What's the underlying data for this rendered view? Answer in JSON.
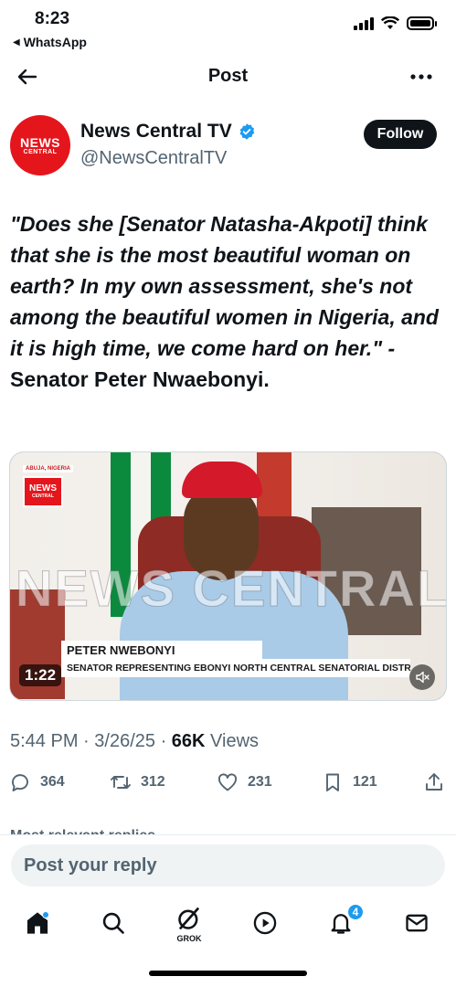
{
  "status": {
    "time": "8:23",
    "back_app": "WhatsApp"
  },
  "nav": {
    "title": "Post"
  },
  "author": {
    "avatar_line1": "NEWS",
    "avatar_line2": "CENTRAL",
    "name": "News Central TV",
    "handle": "@NewsCentralTV",
    "follow_label": "Follow"
  },
  "post": {
    "quote": "\"Does she [Senator Natasha-Akpoti] think that she is the most beautiful woman on earth? In my own assessment, she's not among the beautiful women in Nigeria, and it is high time, we come hard on her.\" -",
    "attribution": "Senator Peter Nwaebonyi."
  },
  "media": {
    "location_tag": "ABUJA, NIGERIA",
    "logo_line1": "NEWS",
    "logo_line2": "CENTRAL",
    "watermark": "NEWS CENTRAL",
    "lower_third_name": "PETER NWEBONYI",
    "lower_third_role": "SENATOR REPRESENTING EBONYI NORTH CENTRAL SENATORIAL DISTRICT",
    "duration": "1:22"
  },
  "meta": {
    "time": "5:44 PM",
    "date": "3/26/25",
    "views": "66K",
    "views_label": "Views"
  },
  "actions": {
    "replies": "364",
    "reposts": "312",
    "likes": "231",
    "bookmarks": "121"
  },
  "replies_peek": "Most relevant replies",
  "reply_placeholder": "Post your reply",
  "tabbar": {
    "grok_label": "GROK",
    "notifications_badge": "4"
  },
  "colors": {
    "accent": "#1d9bf0",
    "brand_red": "#e4161c",
    "text": "#0f1419",
    "muted": "#536471"
  }
}
